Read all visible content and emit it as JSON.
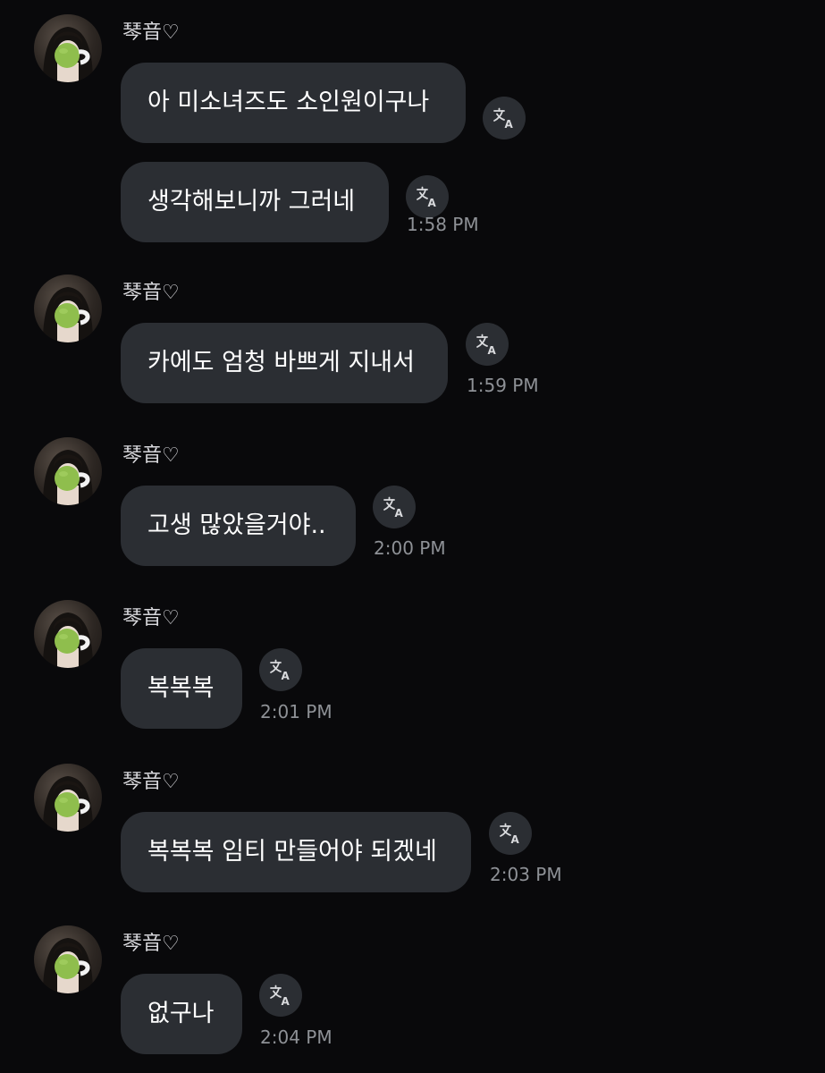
{
  "chat": {
    "sender_name": "琴音♡",
    "translate_icon": "translate-icon",
    "messages": [
      {
        "text": "아 미소녀즈도 소인원이구나",
        "time": ""
      },
      {
        "text": "생각해보니까 그러네",
        "time": "1:58 PM"
      },
      {
        "text": "카에도 엄청 바쁘게 지내서",
        "time": "1:59 PM"
      },
      {
        "text": "고생 많았을거야..",
        "time": "2:00 PM"
      },
      {
        "text": "복복복",
        "time": "2:01 PM"
      },
      {
        "text": "복복복 임티 만들어야 되겠네",
        "time": "2:03 PM"
      },
      {
        "text": "없구나",
        "time": "2:04 PM"
      }
    ]
  },
  "colors": {
    "background": "#09090b",
    "bubble": "#2b2e33",
    "timestamp": "#8e9196"
  }
}
